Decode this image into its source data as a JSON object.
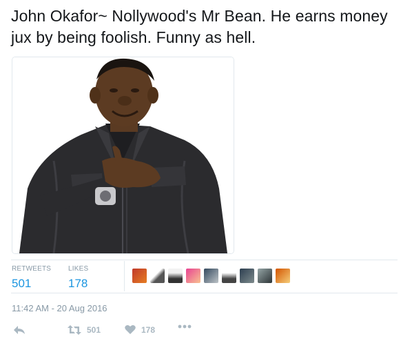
{
  "tweet": {
    "text": "John Okafor~ Nollywood's Mr Bean. He earns money jux by being foolish. Funny as hell."
  },
  "stats": {
    "retweets_label": "RETWEETS",
    "retweets_value": "501",
    "likes_label": "LIKES",
    "likes_value": "178"
  },
  "liked_by_avatars": [
    "avatar-1",
    "avatar-2",
    "avatar-3",
    "avatar-4",
    "avatar-5",
    "avatar-6",
    "avatar-7",
    "avatar-8",
    "avatar-9"
  ],
  "timestamp": "11:42 AM - 20 Aug 2016",
  "actions": {
    "reply_icon": "reply-icon",
    "retweet_icon": "retweet-icon",
    "retweet_count": "501",
    "like_icon": "heart-icon",
    "like_count": "178",
    "more_icon": "more-icon"
  },
  "colors": {
    "accent": "#1b95e0",
    "muted": "#8899a6",
    "icon": "#aab8c2",
    "border": "#e1e8ed"
  }
}
